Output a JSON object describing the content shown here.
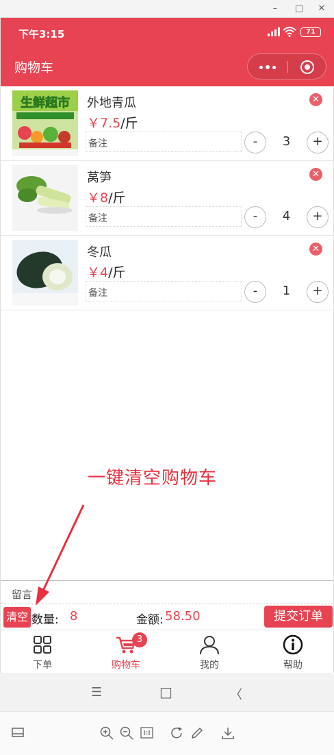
{
  "window": {
    "minimize": "–",
    "maximize": "□",
    "close": "✕"
  },
  "status": {
    "time": "下午3:15",
    "battery": "71"
  },
  "navbar": {
    "title": "购物车"
  },
  "cart": [
    {
      "name": "外地青瓜",
      "price": "￥7.5",
      "unit": "/斤",
      "note": "备注",
      "qty": "3",
      "image_text": "生鲜超市"
    },
    {
      "name": "莴笋",
      "price": "￥8",
      "unit": "/斤",
      "note": "备注",
      "qty": "4"
    },
    {
      "name": "冬瓜",
      "price": "￥4",
      "unit": "/斤",
      "note": "备注",
      "qty": "1"
    }
  ],
  "controls": {
    "minus": "-",
    "plus": "+",
    "delete": "✕"
  },
  "annotation": "一键清空购物车",
  "message": {
    "label": "留言"
  },
  "footer": {
    "clear": "清空",
    "qty_label": "数量:",
    "qty_value": "8",
    "amount_label": "金额:",
    "amount_value": "58.50",
    "submit": "提交订单"
  },
  "tabs": [
    {
      "label": "下单",
      "icon": "grid-icon"
    },
    {
      "label": "购物车",
      "icon": "cart-icon",
      "badge": "3"
    },
    {
      "label": "我的",
      "icon": "user-icon"
    },
    {
      "label": "帮助",
      "icon": "info-icon"
    }
  ],
  "android_nav": {
    "menu": "☰",
    "home": "□",
    "back": "〈"
  },
  "colors": {
    "brand": "#e84352",
    "annotation": "#e8303f"
  }
}
